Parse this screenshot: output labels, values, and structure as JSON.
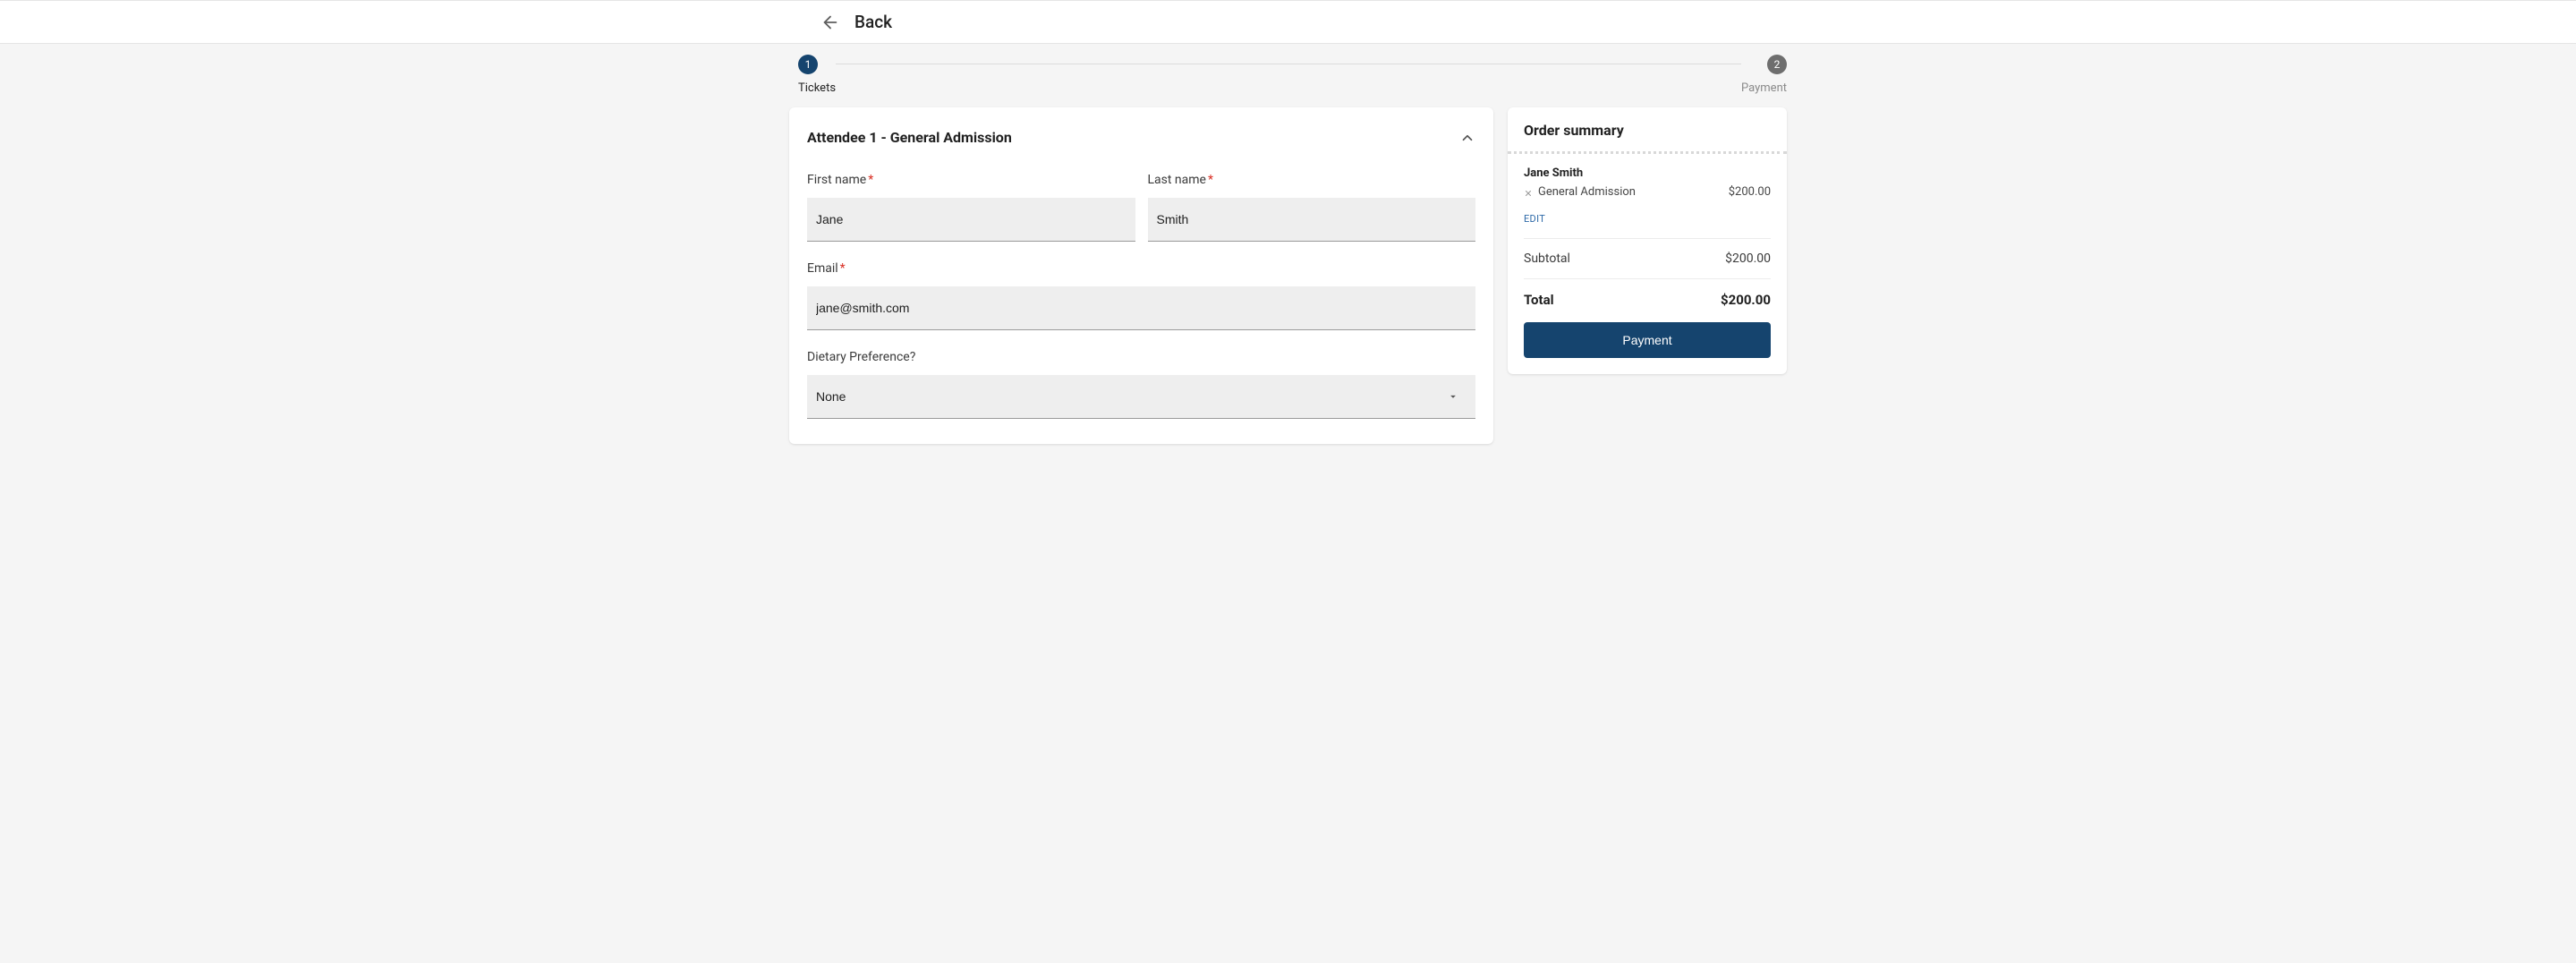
{
  "header": {
    "back_label": "Back"
  },
  "stepper": {
    "step1_num": "1",
    "step1_label": "Tickets",
    "step2_num": "2",
    "step2_label": "Payment"
  },
  "form": {
    "attendee_title": "Attendee 1  -  General Admission",
    "first_name_label": "First name",
    "last_name_label": "Last name",
    "email_label": "Email",
    "dietary_label": "Dietary Preference?",
    "req": "*",
    "first_name_value": "Jane",
    "last_name_value": "Smith",
    "email_value": "jane@smith.com",
    "dietary_value": "None"
  },
  "summary": {
    "title": "Order summary",
    "buyer_name": "Jane Smith",
    "item_label": "General Admission",
    "item_price": "$200.00",
    "edit_label": "EDIT",
    "subtotal_label": "Subtotal",
    "subtotal_value": "$200.00",
    "total_label": "Total",
    "total_value": "$200.00",
    "payment_button": "Payment"
  }
}
